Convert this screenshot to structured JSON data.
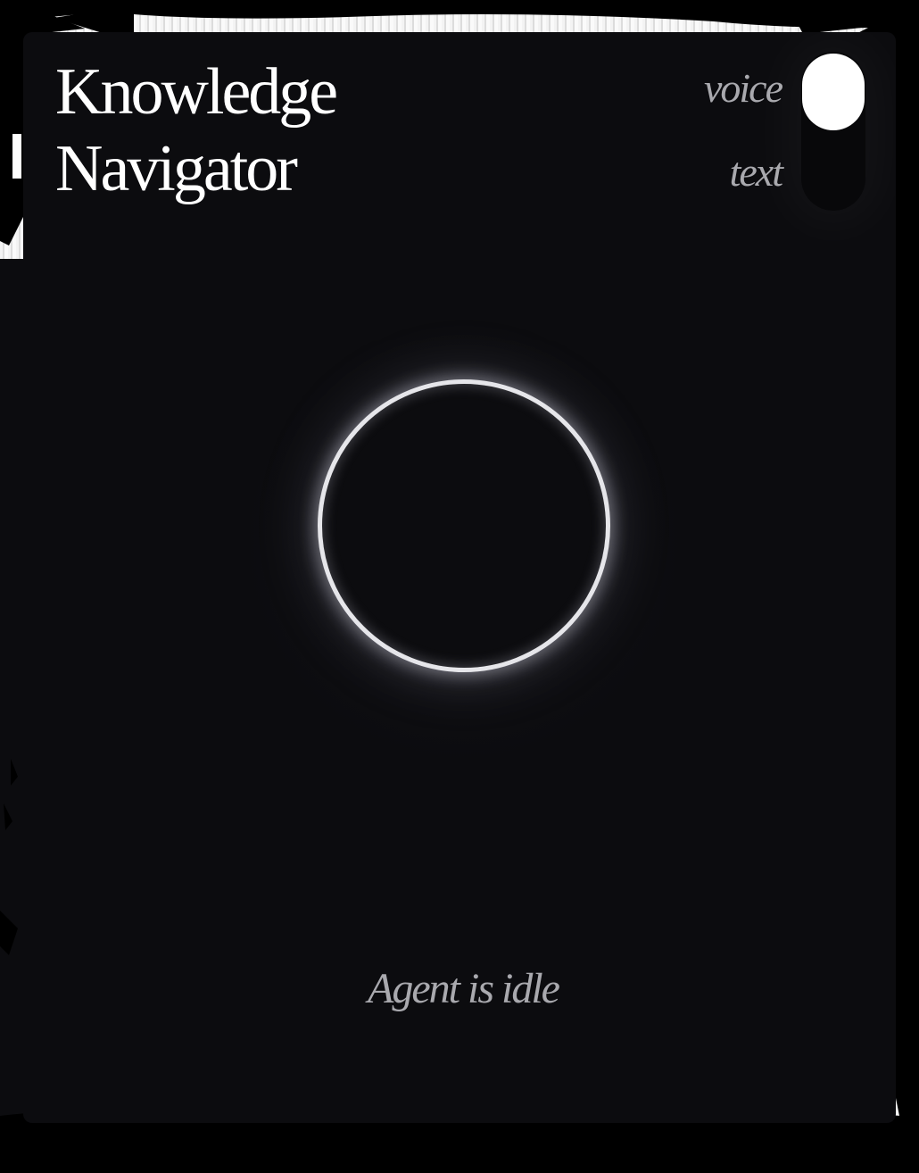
{
  "app": {
    "title_line1": "Knowledge",
    "title_line2": "Navigator"
  },
  "mode_toggle": {
    "option_voice": "voice",
    "option_text": "text",
    "selected": "voice"
  },
  "orb": {
    "icon": "agent-orb-ring"
  },
  "status": {
    "text": "Agent is idle"
  },
  "colors": {
    "background": "#0c0c0f",
    "title": "#ffffff",
    "muted_text": "#a9a9ae",
    "orb_ring": "#e6e6ea"
  }
}
